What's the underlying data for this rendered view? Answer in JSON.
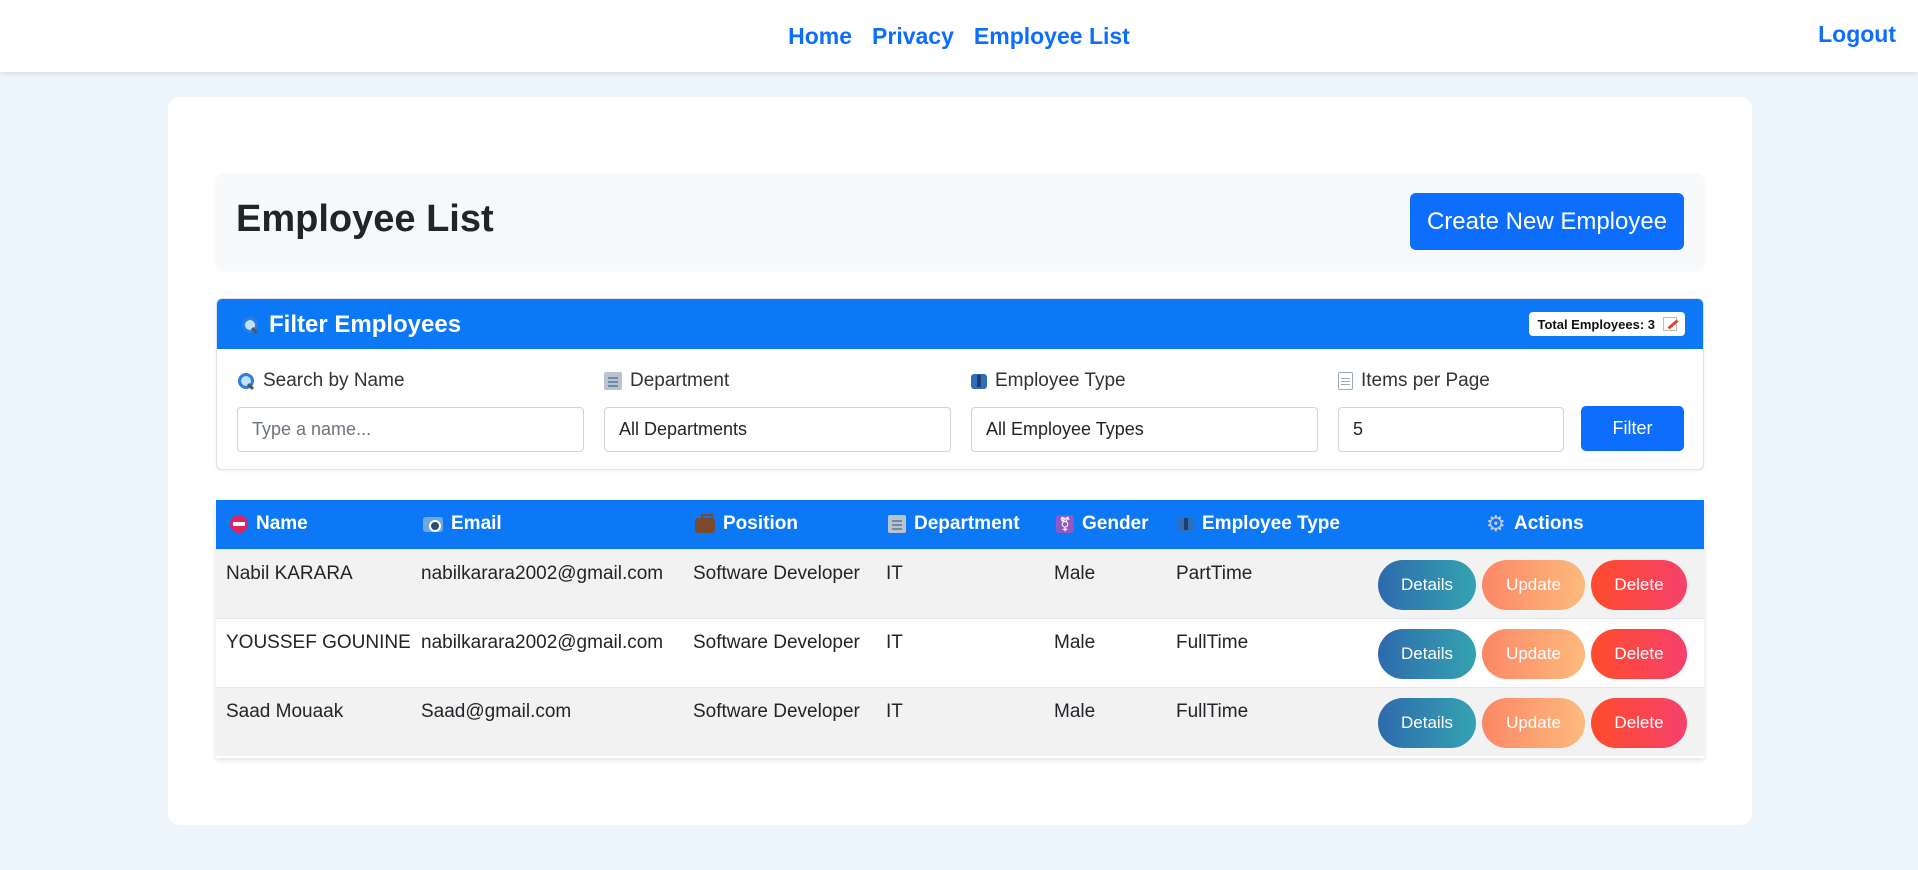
{
  "nav": {
    "links": [
      "Home",
      "Privacy",
      "Employee List"
    ],
    "logout": "Logout"
  },
  "header": {
    "title": "Employee List",
    "create_button": "Create New Employee"
  },
  "filter": {
    "title": "Filter Employees",
    "total_badge": "Total Employees: 3",
    "search": {
      "label": "Search by Name",
      "placeholder": "Type a name...",
      "value": ""
    },
    "department": {
      "label": "Department",
      "value": "All Departments"
    },
    "employee_type": {
      "label": "Employee Type",
      "value": "All Employee Types"
    },
    "items_per_page": {
      "label": "Items per Page",
      "value": "5"
    },
    "button": "Filter"
  },
  "table": {
    "headers": {
      "name": "Name",
      "email": "Email",
      "position": "Position",
      "department": "Department",
      "gender": "Gender",
      "employee_type": "Employee Type",
      "actions": "Actions"
    },
    "rows": [
      {
        "name": "Nabil KARARA",
        "email": "nabilkarara2002@gmail.com",
        "position": "Software Developer",
        "department": "IT",
        "gender": "Male",
        "type": "PartTime"
      },
      {
        "name": "YOUSSEF GOUNINE",
        "email": "nabilkarara2002@gmail.com",
        "position": "Software Developer",
        "department": "IT",
        "gender": "Male",
        "type": "FullTime"
      },
      {
        "name": "Saad Mouaak",
        "email": "Saad@gmail.com",
        "position": "Software Developer",
        "department": "IT",
        "gender": "Male",
        "type": "FullTime"
      }
    ],
    "action_labels": {
      "details": "Details",
      "update": "Update",
      "delete": "Delete"
    }
  },
  "icons": {
    "search": "magnifier-icon",
    "department": "office-building-icon",
    "employee_type": "necktie-icon",
    "items_per_page": "page-icon",
    "name_header": "no-entry-icon",
    "email_header": "camera-icon",
    "position_header": "briefcase-icon",
    "gender_header": "gender-symbol-icon",
    "actions_header": "gear-icon",
    "badge": "memo-icon"
  },
  "colors": {
    "brand_blue": "#0d6efd",
    "header_blue": "#0d78f5",
    "page_bg": "#eef6fd"
  }
}
